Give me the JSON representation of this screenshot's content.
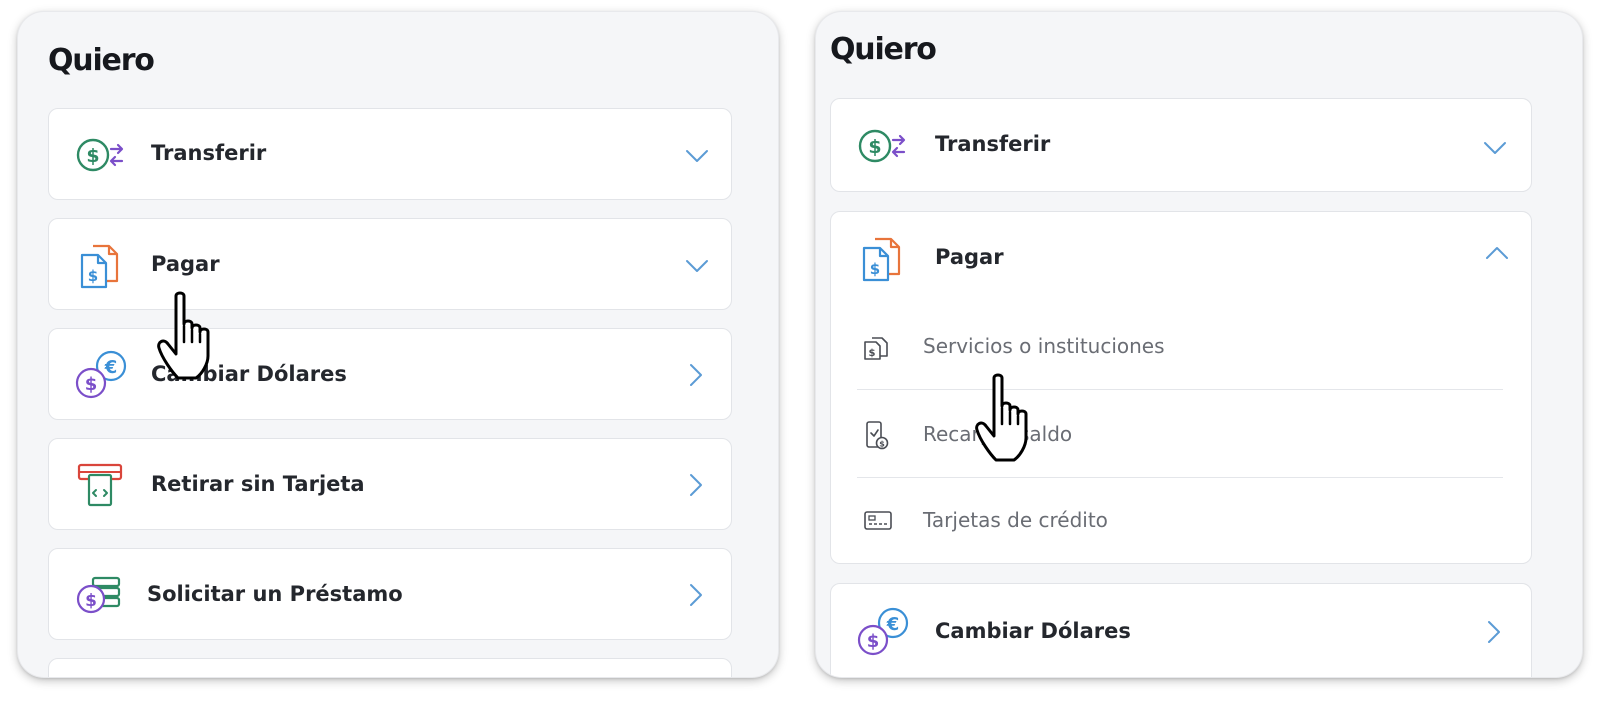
{
  "left_panel": {
    "title": "Quiero",
    "items": [
      {
        "label": "Transferir",
        "icon": "transfer-money-icon",
        "indicator": "chevron-down"
      },
      {
        "label": "Pagar",
        "icon": "pay-bill-icon",
        "indicator": "chevron-down"
      },
      {
        "label": "Cambiar Dólares",
        "icon": "currency-exchange-icon",
        "indicator": "chevron-right"
      },
      {
        "label": "Retirar sin Tarjeta",
        "icon": "atm-withdraw-icon",
        "indicator": "chevron-right"
      },
      {
        "label": "Solicitar un Préstamo",
        "icon": "loan-icon",
        "indicator": "chevron-right"
      }
    ]
  },
  "right_panel": {
    "title": "Quiero",
    "items": [
      {
        "label": "Transferir",
        "icon": "transfer-money-icon",
        "indicator": "chevron-down"
      },
      {
        "label": "Pagar",
        "icon": "pay-bill-icon",
        "indicator": "chevron-up",
        "expanded": true,
        "sub_items": [
          {
            "label": "Servicios o instituciones",
            "icon": "bill-document-icon"
          },
          {
            "label": "Recargar saldo",
            "icon": "phone-recharge-icon"
          },
          {
            "label": "Tarjetas de crédito",
            "icon": "credit-card-icon"
          }
        ]
      },
      {
        "label": "Cambiar Dólares",
        "icon": "currency-exchange-icon",
        "indicator": "chevron-right"
      }
    ]
  },
  "colors": {
    "panel_bg": "#f5f6f8",
    "card_bg": "#ffffff",
    "card_border": "#e2e4e8",
    "title_text": "#16181d",
    "item_text": "#24272d",
    "sub_item_text": "#6a6d74",
    "chevron": "#5b9bd5",
    "icon_green": "#2e8a64",
    "icon_purple": "#7b4fc9",
    "icon_blue": "#3a8fd6",
    "icon_orange": "#e8743b",
    "icon_red": "#d9453b"
  },
  "cursor": {
    "type": "pointer-hand"
  }
}
